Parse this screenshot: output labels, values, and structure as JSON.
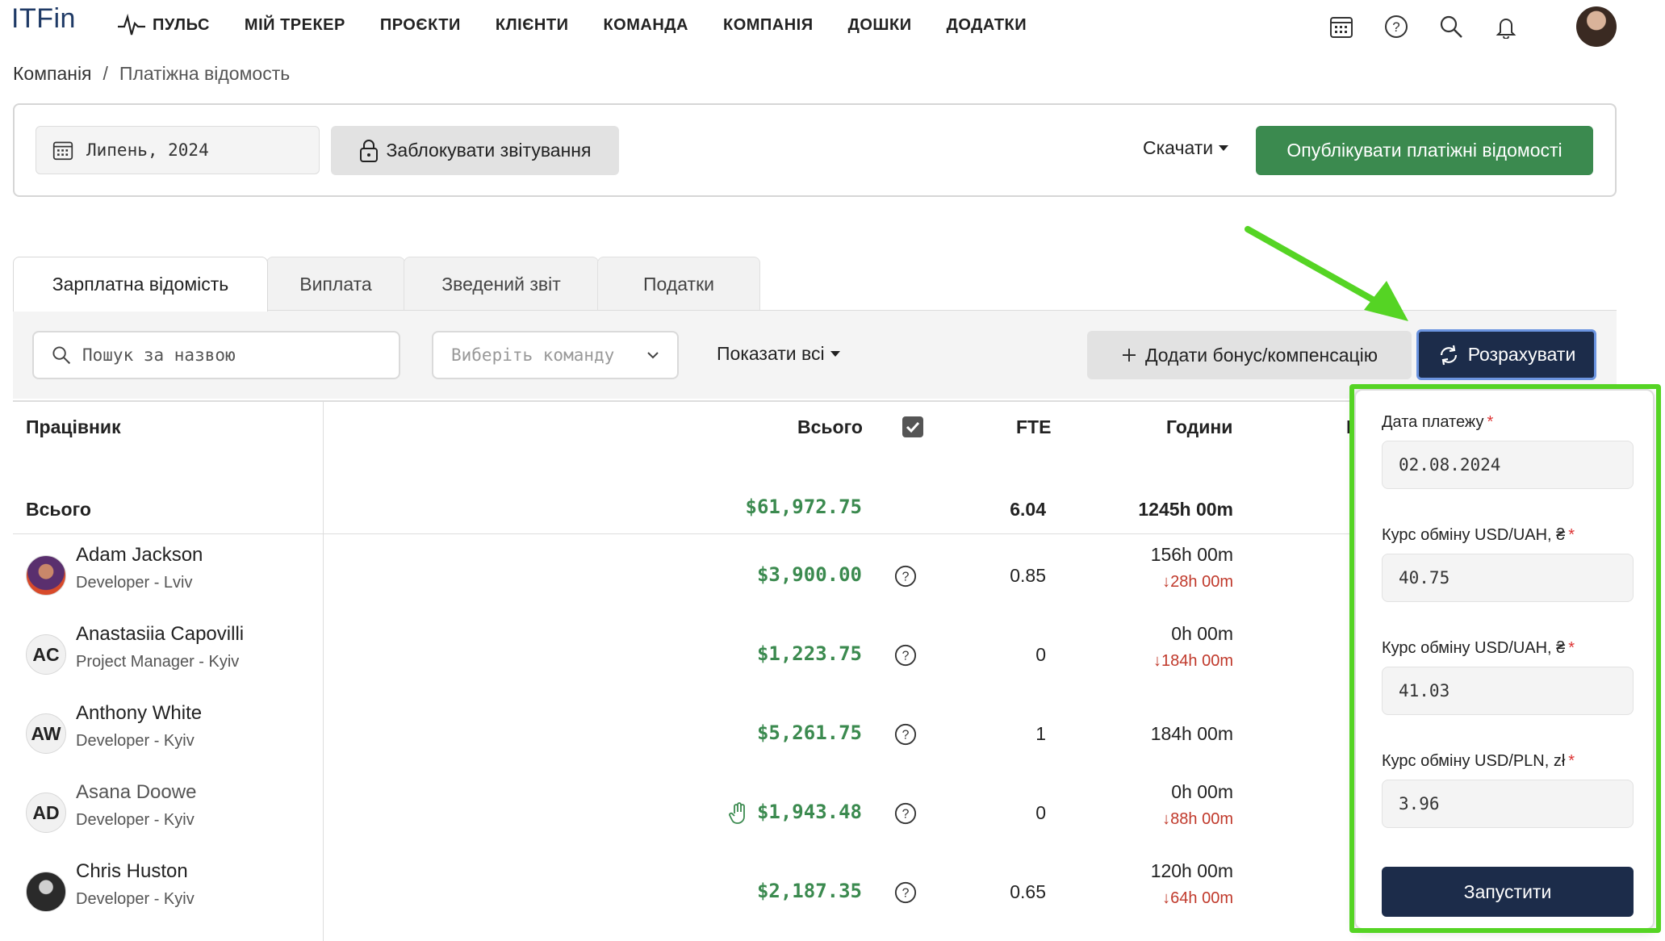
{
  "app": {
    "logo": "ITFin"
  },
  "nav": {
    "items": [
      "ПУЛЬС",
      "МІЙ ТРЕКЕР",
      "ПРОЄКТИ",
      "КЛІЄНТИ",
      "КОМАНДА",
      "КОМПАНІЯ",
      "ДОШКИ",
      "ДОДАТКИ"
    ]
  },
  "breadcrumb": {
    "root": "Компанія",
    "sep": "/",
    "current": "Платіжна відомость"
  },
  "toolbar": {
    "period": "Липень, 2024",
    "lock_label": "Заблокувати звітування",
    "download_label": "Скачати",
    "publish_label": "Опублікувати платіжні відомості"
  },
  "tabs": [
    "Зарплатна відомість",
    "Виплата",
    "Зведений звіт",
    "Податки"
  ],
  "filters": {
    "search_placeholder": "Пошук за назвою",
    "team_placeholder": "Виберіть команду",
    "show_all_label": "Показати всі",
    "bonus_label": "Додати бонус/компенсацію",
    "calculate_label": "Розрахувати"
  },
  "table": {
    "headers": {
      "employee": "Працівник",
      "total": "Всього",
      "fte": "FTE",
      "hours": "Години",
      "partial": "Б"
    },
    "totals": {
      "label": "Всього",
      "sum": "$61,972.75",
      "fte": "6.04",
      "hours": "1245h 00m"
    },
    "rows": [
      {
        "initials": "",
        "name": "Adam Jackson",
        "role": "Developer - Lviv",
        "total": "$3,900.00",
        "fte": "0.85",
        "hours": "156h 00m",
        "deficit": "28h 00m",
        "manual": false,
        "photo": true
      },
      {
        "initials": "AC",
        "name": "Anastasiia Capovilli",
        "role": "Project Manager - Kyiv",
        "total": "$1,223.75",
        "fte": "0",
        "hours": "0h 00m",
        "deficit": "184h 00m",
        "manual": false,
        "photo": false
      },
      {
        "initials": "AW",
        "name": "Anthony White",
        "role": "Developer - Kyiv",
        "total": "$5,261.75",
        "fte": "1",
        "hours": "184h 00m",
        "deficit": "",
        "manual": false,
        "photo": false
      },
      {
        "initials": "AD",
        "name": "Asana Doowe",
        "role": "Developer - Kyiv",
        "total": "$1,943.48",
        "fte": "0",
        "hours": "0h 00m",
        "deficit": "88h 00m",
        "manual": true,
        "photo": false
      },
      {
        "initials": "",
        "name": "Chris Huston",
        "role": "Developer - Kyiv",
        "total": "$2,187.35",
        "fte": "0.65",
        "hours": "120h 00m",
        "deficit": "64h 00m",
        "manual": false,
        "photo": true
      }
    ]
  },
  "calc_popover": {
    "payment_date_label": "Дата платежу",
    "payment_date_value": "02.08.2024",
    "rate1_label": "Курс обміну USD/UAH, ₴",
    "rate1_value": "40.75",
    "rate2_label": "Курс обміну USD/UAH, ₴",
    "rate2_value": "41.03",
    "rate3_label": "Курс обміну USD/PLN, zł",
    "rate3_value": "3.96",
    "required_mark": "*",
    "run_label": "Запустити"
  },
  "colors": {
    "accent_green": "#3b8a4f",
    "navy": "#1c2c4a",
    "highlight": "#55d424",
    "deficit_red": "#c0392b"
  }
}
